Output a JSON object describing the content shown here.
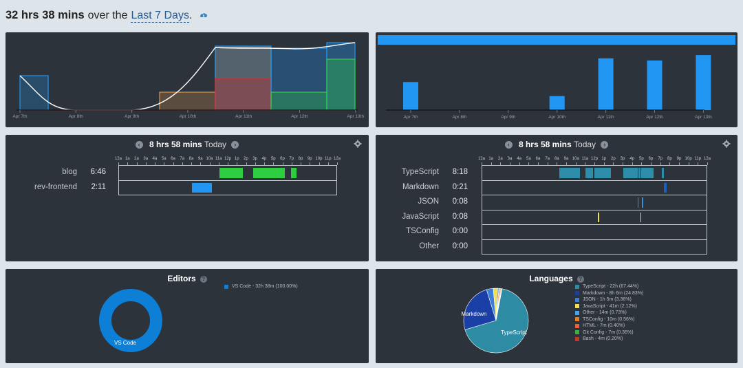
{
  "header": {
    "total": "32 hrs 38 mins",
    "over": "over the",
    "range": "Last 7 Days",
    "period": "."
  },
  "icons": {
    "cloud": "cloud-download-icon",
    "prev": "chevron-left-icon",
    "next": "chevron-right-icon",
    "gear": "gear-icon",
    "help": "question-icon"
  },
  "colors": {
    "bg": "#dde4ea",
    "panel": "#2d333b",
    "accent": "#2196f3",
    "green": "#2ecc40"
  },
  "activity_chart": {
    "chart_data": {
      "type": "area",
      "categories": [
        "Apr 7th",
        "Apr 8th",
        "Apr 9th",
        "Apr 10th",
        "Apr 11th",
        "Apr 12th",
        "Apr 13th"
      ]
    }
  },
  "daily_bars": {
    "chart_data": {
      "type": "bar",
      "categories": [
        "Apr 7th",
        "Apr 8th",
        "Apr 9th",
        "Apr 10th",
        "Apr 11th",
        "Apr 12th",
        "Apr 13th"
      ],
      "values": [
        2.6,
        0,
        0,
        1.3,
        4.8,
        4.6,
        5.1
      ],
      "ylim": [
        0,
        6
      ]
    }
  },
  "projects": {
    "title": "8 hrs 58 mins",
    "subtitle": "Today",
    "ticks": [
      "12a",
      "1a",
      "2a",
      "3a",
      "4a",
      "5a",
      "6a",
      "7a",
      "8a",
      "9a",
      "10a",
      "11a",
      "12p",
      "1p",
      "2p",
      "3p",
      "4p",
      "5p",
      "6p",
      "7p",
      "8p",
      "9p",
      "10p",
      "11p",
      "12a"
    ],
    "rows": [
      {
        "name": "blog",
        "time": "6:46",
        "color": "#2ecc40",
        "segments": [
          [
            11.0,
            13.6
          ],
          [
            14.7,
            18.2
          ],
          [
            18.9,
            19.5
          ]
        ]
      },
      {
        "name": "rev-frontend",
        "time": "2:11",
        "color": "#2196f3",
        "segments": [
          [
            8.0,
            10.2
          ]
        ]
      }
    ]
  },
  "languages_timeline": {
    "title": "8 hrs 58 mins",
    "subtitle": "Today",
    "ticks": [
      "12a",
      "1a",
      "2a",
      "3a",
      "4a",
      "5a",
      "6a",
      "7a",
      "8a",
      "9a",
      "10a",
      "11a",
      "12p",
      "1p",
      "2p",
      "3p",
      "4p",
      "5p",
      "6p",
      "7p",
      "8p",
      "9p",
      "10p",
      "11p",
      "12a"
    ],
    "rows": [
      {
        "name": "TypeScript",
        "time": "8:18",
        "color": "#2e8eaa",
        "segments": [
          [
            8.2,
            10.4
          ],
          [
            11.0,
            11.8
          ],
          [
            11.9,
            13.7
          ],
          [
            15.0,
            16.5
          ],
          [
            16.6,
            16.8
          ],
          [
            16.9,
            18.2
          ],
          [
            19.1,
            19.3
          ]
        ]
      },
      {
        "name": "Markdown",
        "time": "0:21",
        "color": "#1d5fbf",
        "segments": [
          [
            19.3,
            19.6
          ]
        ]
      },
      {
        "name": "JSON",
        "time": "0:08",
        "color": "#3d8fd1",
        "segments": [
          [
            16.5,
            16.6
          ],
          [
            17.0,
            17.1
          ]
        ]
      },
      {
        "name": "JavaScript",
        "time": "0:08",
        "color": "#f0e050",
        "segments": [
          [
            12.3,
            12.35
          ],
          [
            16.8,
            16.9
          ]
        ]
      },
      {
        "name": "TSConfig",
        "time": "0:00",
        "color": "#e67e22",
        "segments": []
      },
      {
        "name": "Other",
        "time": "0:00",
        "color": "#888888",
        "segments": []
      }
    ]
  },
  "editors": {
    "title": "Editors",
    "chart_data": {
      "type": "pie",
      "slices": [
        {
          "label": "VS Code",
          "value": 100.0,
          "color": "#0e7fd6"
        }
      ]
    },
    "legend": [
      "VS Code - 32h 38m (100.00%)"
    ],
    "slice_label": "VS Code"
  },
  "languages": {
    "title": "Languages",
    "chart_data": {
      "type": "pie",
      "slices": [
        {
          "label": "TypeScript",
          "value": 67.44,
          "color": "#2e8ba4"
        },
        {
          "label": "Markdown",
          "value": 24.83,
          "color": "#1a3fa6"
        },
        {
          "label": "JSON",
          "value": 3.36,
          "color": "#3d7ed6"
        },
        {
          "label": "JavaScript",
          "value": 2.12,
          "color": "#f0e050"
        },
        {
          "label": "Other",
          "value": 0.73,
          "color": "#4aa3e8"
        },
        {
          "label": "TSConfig",
          "value": 0.56,
          "color": "#e67e22"
        },
        {
          "label": "HTML",
          "value": 0.4,
          "color": "#e8623a"
        },
        {
          "label": "Git Config",
          "value": 0.36,
          "color": "#3cb043"
        },
        {
          "label": "Bash",
          "value": 0.2,
          "color": "#c0392b"
        }
      ]
    },
    "legend": [
      "TypeScript - 22h (67.44%)",
      "Markdown - 8h 6m (24.83%)",
      "JSON - 1h 5m (3.36%)",
      "JavaScript - 41m (2.12%)",
      "Other - 14m (0.73%)",
      "TSConfig - 10m (0.56%)",
      "HTML - 7m (0.40%)",
      "Git Config - 7m (0.36%)",
      "Bash - 4m (0.20%)"
    ],
    "slice_labels": {
      "big": "TypeScript",
      "second": "Markdown"
    }
  }
}
